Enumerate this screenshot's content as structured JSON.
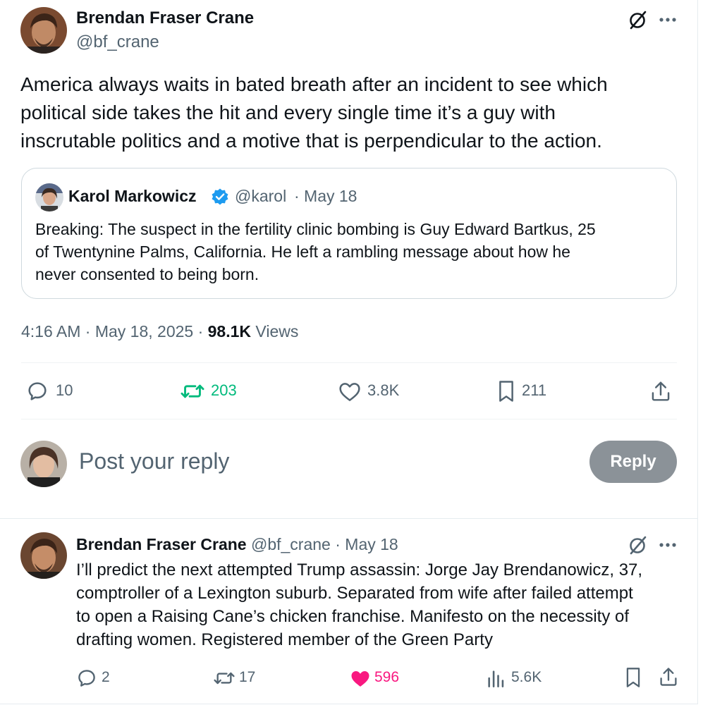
{
  "main_post": {
    "author_name": "Brendan Fraser Crane",
    "author_handle": "@bf_crane",
    "text_lines": [
      "America always waits in bated breath after an incident to see which",
      "political side takes the hit and every single time it’s a guy with",
      "inscrutable politics and a motive that is perpendicular to the action."
    ],
    "quote": {
      "author_name": "Karol Markowicz",
      "author_handle": "@karol",
      "date": "· May 18",
      "text_lines": [
        "Breaking: The suspect in the fertility clinic bombing is Guy Edward Bartkus, 25",
        "of Twentynine Palms, California. He left a rambling message about how he",
        "never consented to being born."
      ]
    },
    "timestamp": "4:16 AM · May 18, 2025 ·",
    "views_count": "98.1K",
    "views_label": "Views",
    "actions": {
      "replies": "10",
      "reposts": "203",
      "likes": "3.8K",
      "bookmarks": "211"
    }
  },
  "reply_composer": {
    "placeholder": "Post your reply",
    "button_label": "Reply"
  },
  "reply_post": {
    "author_name": "Brendan Fraser Crane",
    "author_handle": "@bf_crane",
    "date": "· May 18",
    "text_lines": [
      "I’ll predict the next attempted Trump assassin: Jorge Jay Brendanowicz, 37,",
      "comptroller of a Lexington suburb. Separated from wife after failed attempt",
      "to open a Raising Cane’s chicken franchise. Manifesto on the necessity of",
      "drafting women. Registered member of the Green Party"
    ],
    "actions": {
      "replies": "2",
      "reposts": "17",
      "likes": "596",
      "views": "5.6K"
    }
  },
  "colors": {
    "text_primary": "#0f1419",
    "text_secondary": "#536471",
    "repost_active": "#00ba7c",
    "like_active": "#f91880",
    "verified_blue": "#1d9bf0",
    "reply_button": "#8b9298"
  }
}
